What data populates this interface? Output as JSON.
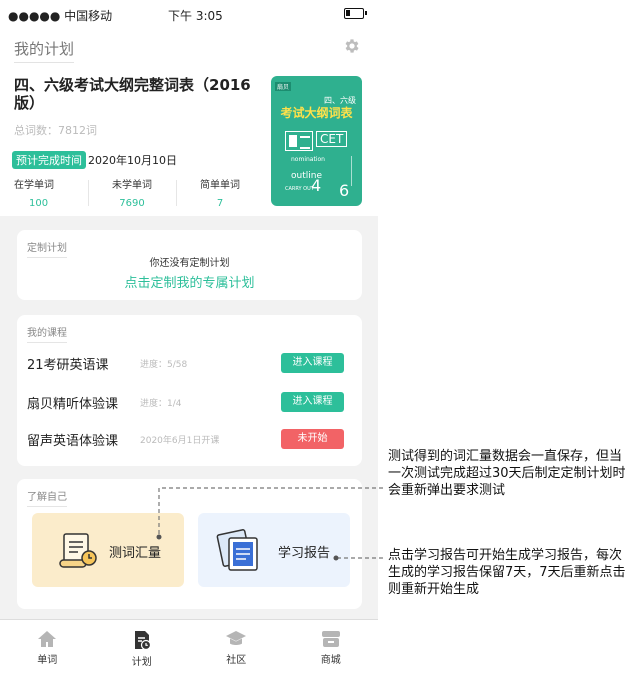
{
  "status_bar": {
    "carrier": "●●●●● 中国移动",
    "time": "下午 3:05"
  },
  "header": {
    "title": "我的计划",
    "settings_icon": "gear-icon"
  },
  "book": {
    "title": "四、六级考试大纲完整词表（2016版）",
    "word_count": "总词数：7812词",
    "finish_badge": "预计完成时间",
    "finish_date": "2020年10月10日",
    "stats": [
      {
        "label": "在学单词",
        "value": "100"
      },
      {
        "label": "未学单词",
        "value": "7690"
      },
      {
        "label": "简单单词",
        "value": "7"
      }
    ],
    "cover": {
      "brand": "扇贝",
      "level": "四、六级",
      "title": "考试大纲词表",
      "tag": "CET",
      "word1": "nomination",
      "word2": "outline",
      "word3": "CARRY OUT",
      "num1": "4",
      "num2": "6"
    }
  },
  "plan_card": {
    "title": "定制计划",
    "empty_text": "你还没有定制计划",
    "action": "点击定制我的专属计划"
  },
  "courses_card": {
    "title": "我的课程",
    "items": [
      {
        "name": "21考研英语课",
        "progress": "进度：5/58",
        "button": "进入课程",
        "status": "green"
      },
      {
        "name": "扇贝精听体验课",
        "progress": "进度：1/4",
        "button": "进入课程",
        "status": "green"
      },
      {
        "name": "留声英语体验课",
        "progress": "2020年6月1日开课",
        "button": "未开始",
        "status": "red"
      }
    ]
  },
  "know_card": {
    "title": "了解自己",
    "tiles": [
      {
        "label": "测词汇量",
        "icon": "scroll-clock-icon"
      },
      {
        "label": "学习报告",
        "icon": "report-icon"
      }
    ]
  },
  "tabbar": [
    {
      "label": "单词",
      "icon": "home-icon"
    },
    {
      "label": "计划",
      "icon": "plan-icon"
    },
    {
      "label": "社区",
      "icon": "graduation-cap-icon"
    },
    {
      "label": "商城",
      "icon": "shop-icon"
    }
  ],
  "annotations": {
    "vocab_test": "测试得到的词汇量数据会一直保存，但当一次测试完成超过30天后制定定制计划时会重新弹出要求测试",
    "report": "点击学习报告可开始生成学习报告，每次生成的学习报告保留7天，7天后重新点击则重新开始生成"
  },
  "colors": {
    "accent": "#2dbf9a",
    "danger": "#f26366",
    "tile_yellow": "#fbeccb",
    "tile_blue": "#ecf3fd"
  }
}
